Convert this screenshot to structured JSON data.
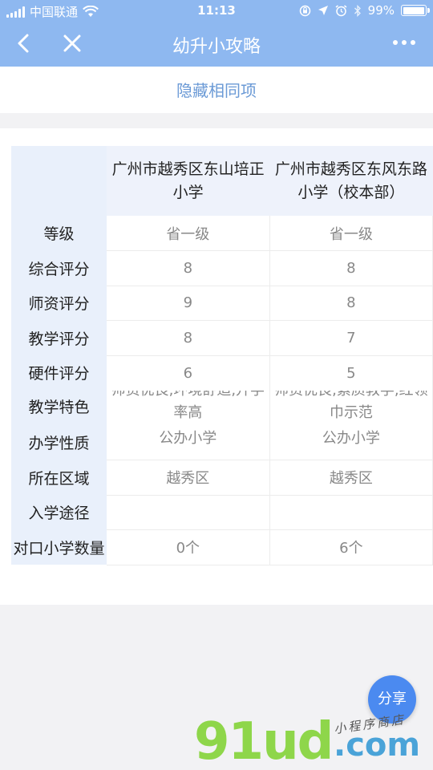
{
  "status": {
    "carrier": "中国联通",
    "time": "11:13",
    "battery": "99%",
    "battery_level": 0.99
  },
  "nav": {
    "title": "幼升小攻略"
  },
  "hide_same_label": "隐藏相同项",
  "schools": [
    {
      "name_line1": "广州市越秀区东山培正",
      "name_line2": "小学"
    },
    {
      "name_line1": "广州市越秀区东风东路",
      "name_line2": "小学（校本部）"
    }
  ],
  "rows": [
    {
      "label": "等级",
      "values": [
        "省一级",
        "省一级"
      ]
    },
    {
      "label": "综合评分",
      "values": [
        "8",
        "8"
      ]
    },
    {
      "label": "师资评分",
      "values": [
        "9",
        "8"
      ]
    },
    {
      "label": "教学评分",
      "values": [
        "8",
        "7"
      ]
    },
    {
      "label": "硬件评分",
      "values": [
        "6",
        "5"
      ]
    },
    {
      "label": "教学特色",
      "values": [
        {
          "line1": "师资优良,环境舒适,升学",
          "line2": "率高"
        },
        {
          "line1": "师资优良,素质教学,红领",
          "line2": "巾示范"
        }
      ]
    },
    {
      "label": "办学性质",
      "values": [
        "公办小学",
        "公办小学"
      ]
    },
    {
      "label": "所在区域",
      "values": [
        "越秀区",
        "越秀区"
      ]
    },
    {
      "label": "入学途径",
      "values": [
        "",
        ""
      ]
    },
    {
      "label": "对口小学数量",
      "values": [
        "0个",
        "6个"
      ]
    }
  ],
  "share_label": "分享",
  "watermark": {
    "main": "91ud",
    "suffix": ".com",
    "sub": "小程序商店"
  },
  "icons": {
    "back": "chevron-left-icon",
    "close": "close-icon",
    "more": "more-dots-icon",
    "wifi": "wifi-icon",
    "location": "location-arrow-icon",
    "alarm": "alarm-icon",
    "bluetooth": "bluetooth-icon",
    "rotation_lock": "rotation-lock-icon"
  },
  "colors": {
    "nav_bg": "#8eb8f0",
    "link": "#6b9ad6",
    "share_bg": "#4b8af0",
    "label_bg": "#e9f0fb"
  }
}
